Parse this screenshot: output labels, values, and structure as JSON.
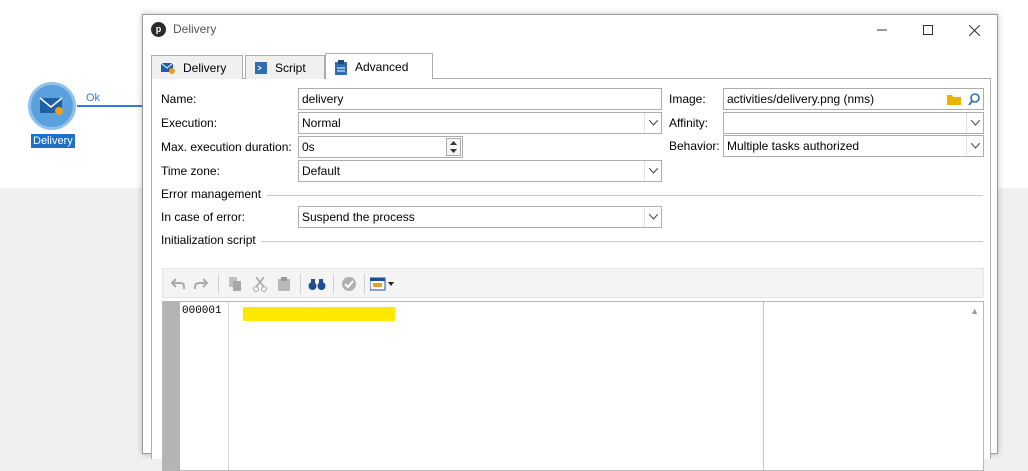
{
  "workflow": {
    "node_label": "Delivery",
    "transition_label": "Ok"
  },
  "window": {
    "title": "Delivery",
    "app_icon": "p"
  },
  "tabs": [
    {
      "label": "Delivery",
      "icon": "delivery-icon"
    },
    {
      "label": "Script",
      "icon": "script-icon"
    },
    {
      "label": "Advanced",
      "icon": "clipboard-icon",
      "active": true
    }
  ],
  "form": {
    "name_label": "Name:",
    "name_value": "delivery",
    "execution_label": "Execution:",
    "execution_value": "Normal",
    "max_duration_label": "Max. execution duration:",
    "max_duration_value": "0s",
    "timezone_label": "Time zone:",
    "timezone_value": "Default",
    "image_label": "Image:",
    "image_value": "activities/delivery.png (nms)",
    "affinity_label": "Affinity:",
    "affinity_value": "",
    "behavior_label": "Behavior:",
    "behavior_value": "Multiple tasks authorized"
  },
  "error_management": {
    "title": "Error management",
    "in_case_label": "In case of error:",
    "in_case_value": "Suspend the process"
  },
  "init_script": {
    "title": "Initialization script",
    "line_number": "000001",
    "toolbar_icons": [
      "undo-icon",
      "redo-icon",
      "copy-icon",
      "cut-icon",
      "paste-icon",
      "find-icon",
      "check-icon",
      "insert-icon"
    ]
  },
  "colors": {
    "accent": "#1f6fc5",
    "highlight": "#ffe800",
    "node": "#5aa0dc"
  }
}
